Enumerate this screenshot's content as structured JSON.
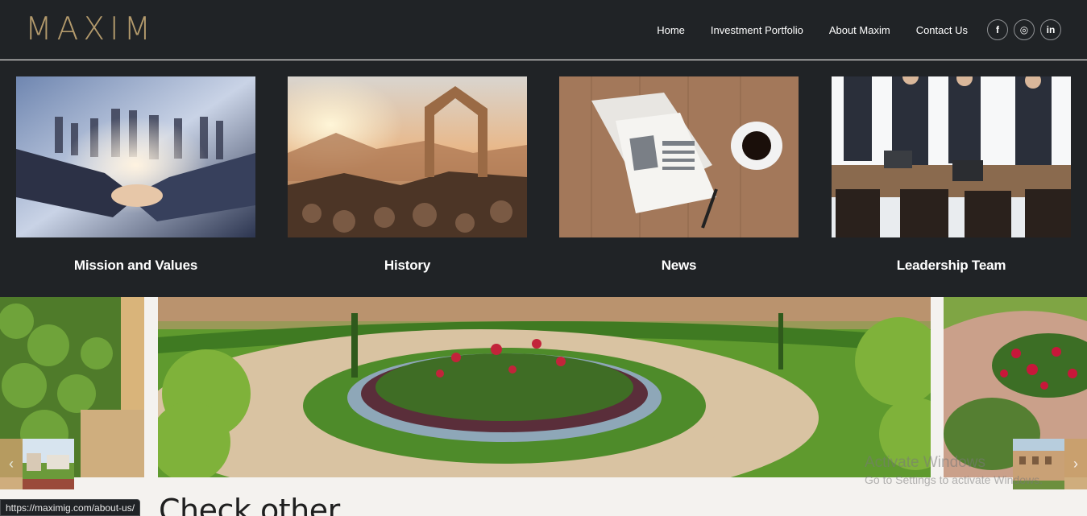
{
  "brand": {
    "logo_text": "MAXIM",
    "accent_color": "#b39a6c"
  },
  "nav": {
    "items": [
      {
        "label": "Home"
      },
      {
        "label": "Investment Portfolio"
      },
      {
        "label": "About Maxim"
      },
      {
        "label": "Contact Us"
      }
    ],
    "social": [
      {
        "icon": "facebook-icon",
        "glyph": "f"
      },
      {
        "icon": "instagram-icon",
        "glyph": "◎"
      },
      {
        "icon": "linkedin-icon",
        "glyph": "in"
      }
    ]
  },
  "dropdown": {
    "cards": [
      {
        "label": "Mission and Values",
        "image": "business-handshake-image"
      },
      {
        "label": "History",
        "image": "house-frame-sunset-image"
      },
      {
        "label": "News",
        "image": "newspaper-coffee-image"
      },
      {
        "label": "Leadership Team",
        "image": "business-meeting-image"
      }
    ]
  },
  "slider": {
    "prev_glyph": "‹",
    "next_glyph": "›"
  },
  "content": {
    "heading": "Check other"
  },
  "status_bar": {
    "url": "https://maximig.com/about-us/"
  },
  "watermark": {
    "line1": "Activate Windows",
    "line2": "Go to Settings to activate Windows."
  }
}
